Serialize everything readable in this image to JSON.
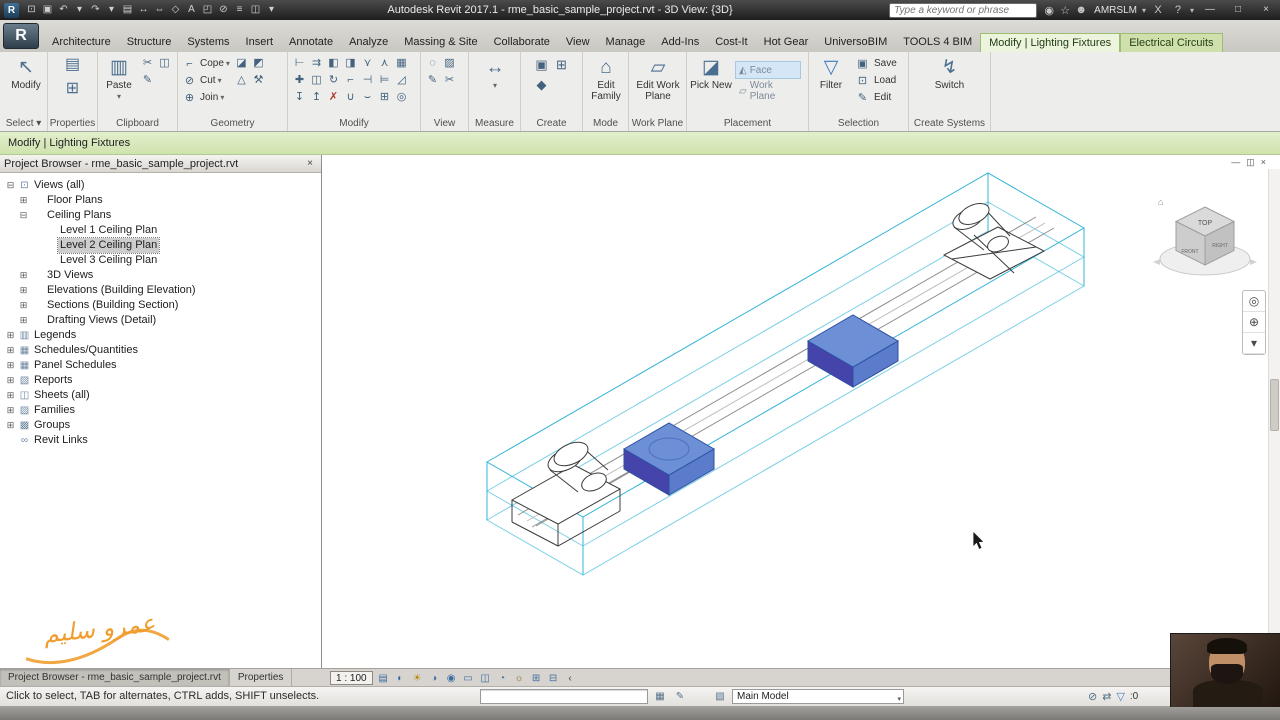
{
  "theme": {
    "model_cyan": "#35b5d8",
    "selection_blue_top": "#6d8fd6",
    "selection_blue_left": "#44a",
    "selection_blue_right": "#5a7cca",
    "selection_blue_edge": "#2e51a3",
    "contextual_green": "#e2efcd",
    "watermark_orange": "#f09d2e"
  },
  "glyphs": {
    "caret": "▾",
    "expand_toggle": "▾"
  },
  "titlebar": {
    "app_icon": "R",
    "title": "Autodesk Revit 2017.1 - rme_basic_sample_project.rvt - 3D View: {3D}",
    "qat": [
      {
        "name": "open-icon",
        "glyph": "⊡"
      },
      {
        "name": "save-icon",
        "glyph": "▣"
      },
      {
        "name": "undo-icon",
        "glyph": "↶"
      },
      {
        "name": "undo-caret-icon",
        "glyph": "▾"
      },
      {
        "name": "redo-icon",
        "glyph": "↷"
      },
      {
        "name": "redo-caret-icon",
        "glyph": "▾"
      },
      {
        "name": "print-icon",
        "glyph": "▤"
      },
      {
        "name": "measure-qat-icon",
        "glyph": "↔"
      },
      {
        "name": "aligned-dimension-icon",
        "glyph": "⇔"
      },
      {
        "name": "tag-by-category-icon",
        "glyph": "◇"
      },
      {
        "name": "text-icon",
        "glyph": "A"
      },
      {
        "name": "default-3d-view-icon",
        "glyph": "◰"
      },
      {
        "name": "section-icon",
        "glyph": "⊘"
      },
      {
        "name": "thin-lines-icon",
        "glyph": "≡"
      },
      {
        "name": "switch-windows-icon",
        "glyph": "◫"
      },
      {
        "name": "customize-qat-icon",
        "glyph": "▾"
      }
    ],
    "search_placeholder": "Type a keyword or phrase",
    "search_icons": [
      {
        "name": "search-binoculars-icon",
        "glyph": "◉"
      },
      {
        "name": "favorites-star-icon",
        "glyph": "☆"
      },
      {
        "name": "sign-in-user-icon",
        "glyph": "☻"
      }
    ],
    "user": "AMRSLM",
    "user_caret": "▾",
    "exchange_apps": "X",
    "help": "?",
    "help_caret": "▾",
    "window": {
      "minimize": "—",
      "maximize": "□",
      "close": "×"
    }
  },
  "ribbon": {
    "app_button": "R",
    "ribbon_toggle": "▾",
    "tabs": [
      {
        "name": "tab-architecture",
        "label": "Architecture"
      },
      {
        "name": "tab-structure",
        "label": "Structure"
      },
      {
        "name": "tab-systems",
        "label": "Systems"
      },
      {
        "name": "tab-insert",
        "label": "Insert"
      },
      {
        "name": "tab-annotate",
        "label": "Annotate"
      },
      {
        "name": "tab-analyze",
        "label": "Analyze"
      },
      {
        "name": "tab-massing-site",
        "label": "Massing & Site"
      },
      {
        "name": "tab-collaborate",
        "label": "Collaborate"
      },
      {
        "name": "tab-view",
        "label": "View"
      },
      {
        "name": "tab-manage",
        "label": "Manage"
      },
      {
        "name": "tab-add-ins",
        "label": "Add-Ins"
      },
      {
        "name": "tab-cost-it",
        "label": "Cost-It"
      },
      {
        "name": "tab-hot-gear",
        "label": "Hot Gear"
      },
      {
        "name": "tab-universobim",
        "label": "UniversoBIM"
      },
      {
        "name": "tab-tools-4-bim",
        "label": "TOOLS 4 BIM"
      },
      {
        "name": "tab-modify-lighting-fixtures",
        "label": "Modify | Lighting Fixtures",
        "state": "contextual-active"
      },
      {
        "name": "tab-electrical-circuits",
        "label": "Electrical Circuits",
        "state": "contextual"
      }
    ],
    "select_panel": {
      "label": "Select ▾",
      "modify_icon": "↖",
      "modify_label": "Modify"
    },
    "properties_panel": {
      "label": "Properties",
      "icons": [
        {
          "name": "properties-palette-icon",
          "glyph": "▤"
        },
        {
          "name": "family-types-icon",
          "glyph": "⊞"
        }
      ]
    },
    "clipboard_panel": {
      "label": "Clipboard",
      "paste_icon": "▥",
      "paste_label": "Paste",
      "paste_caret": "▾",
      "icons": [
        {
          "name": "cut-icon",
          "glyph": "✂"
        },
        {
          "name": "copy-icon",
          "glyph": "◫"
        },
        {
          "name": "match-type-icon",
          "glyph": "✎"
        }
      ]
    },
    "geometry_panel": {
      "label": "Geometry",
      "rows": [
        {
          "name": "cope-button",
          "icon": "⌐",
          "label": "Cope",
          "caret": "▾"
        },
        {
          "name": "cut-button",
          "icon": "⊘",
          "label": "Cut",
          "caret": "▾"
        },
        {
          "name": "join-button",
          "icon": "⊕",
          "label": "Join",
          "caret": "▾"
        }
      ],
      "icons": [
        {
          "name": "paint-icon",
          "glyph": "◪"
        },
        {
          "name": "remove-paint-icon",
          "glyph": "◩"
        },
        {
          "name": "split-face-icon",
          "glyph": "△"
        },
        {
          "name": "demolish-icon",
          "glyph": "⚒"
        }
      ]
    },
    "modify_panel": {
      "label": "Modify",
      "icons": [
        {
          "name": "align-icon",
          "glyph": "⊢"
        },
        {
          "name": "offset-icon",
          "glyph": "⇉"
        },
        {
          "name": "mirror-pick-axis-icon",
          "glyph": "◧"
        },
        {
          "name": "mirror-draw-axis-icon",
          "glyph": "◨"
        },
        {
          "name": "split-element-icon",
          "glyph": "⋎"
        },
        {
          "name": "split-with-gap-icon",
          "glyph": "⋏"
        },
        {
          "name": "array-icon",
          "glyph": "▦"
        },
        {
          "name": "move-icon",
          "glyph": "✚"
        },
        {
          "name": "copy-icon",
          "glyph": "◫"
        },
        {
          "name": "rotate-icon",
          "glyph": "↻"
        },
        {
          "name": "trim-extend-corner-icon",
          "glyph": "⌐"
        },
        {
          "name": "trim-extend-single-icon",
          "glyph": "⊣"
        },
        {
          "name": "trim-extend-multiple-icon",
          "glyph": "⊨"
        },
        {
          "name": "scale-icon",
          "glyph": "◿"
        },
        {
          "name": "pin-icon",
          "glyph": "↧"
        },
        {
          "name": "unpin-icon",
          "glyph": "↥"
        },
        {
          "name": "delete-icon",
          "glyph": "✗",
          "color": "#b03a2e"
        },
        {
          "name": "join-geometry-icon",
          "glyph": "∪"
        },
        {
          "name": "unjoin-geometry-icon",
          "glyph": "⌣"
        },
        {
          "name": "wall-joins-icon",
          "glyph": "⊞"
        },
        {
          "name": "activate-controls-icon",
          "glyph": "◎"
        }
      ]
    },
    "view_panel": {
      "label": "View",
      "icons": [
        {
          "name": "hide-elements-icon",
          "glyph": "◌"
        },
        {
          "name": "override-graphics-icon",
          "glyph": "▨"
        },
        {
          "name": "linework-icon",
          "glyph": "✎"
        },
        {
          "name": "cut-profile-icon",
          "glyph": "✂"
        }
      ]
    },
    "measure_panel": {
      "label": "Measure",
      "icon": "↔",
      "caret": "▾"
    },
    "create_panel": {
      "label": "Create",
      "icons": [
        {
          "name": "create-parts-icon",
          "glyph": "▣"
        },
        {
          "name": "create-group-icon",
          "glyph": "⊞"
        },
        {
          "name": "create-similar-icon",
          "glyph": "◆"
        }
      ]
    },
    "mode_panel": {
      "label": "Mode",
      "edit_family_icon": "⌂",
      "edit_family_label": "Edit Family"
    },
    "work_plane_panel": {
      "label": "Work Plane",
      "edit_work_plane_icon": "▱",
      "edit_work_plane_label": "Edit Work Plane"
    },
    "placement_panel": {
      "label": "Placement",
      "pick_new_icon": "◪",
      "pick_new_label": "Pick New",
      "face_icon": "◭",
      "face_label": "Face",
      "work_plane_icon": "▱",
      "work_plane_label": "Work Plane"
    },
    "selection_panel": {
      "label": "Selection",
      "filter_icon": "▽",
      "filter_label": "Filter",
      "items": [
        {
          "name": "save-selection-button",
          "glyph": "▣",
          "label": "Save"
        },
        {
          "name": "load-selection-button",
          "glyph": "⊡",
          "label": "Load"
        },
        {
          "name": "edit-selection-button",
          "glyph": "✎",
          "label": "Edit"
        }
      ]
    },
    "create_systems_panel": {
      "label": "Create Systems",
      "switch_icon": "↯",
      "switch_label": "Switch"
    }
  },
  "context_bar": {
    "label": "Modify | Lighting Fixtures"
  },
  "project_browser": {
    "title": "Project Browser - rme_basic_sample_project.rvt",
    "close": "×",
    "tree": [
      {
        "name": "tree-item-views-all",
        "indent": 0,
        "glyph": "⊟",
        "icon": "⊡",
        "label": "Views (all)"
      },
      {
        "name": "tree-item-floor-plans",
        "indent": 1,
        "glyph": "⊞",
        "icon": "",
        "label": "Floor Plans"
      },
      {
        "name": "tree-item-ceiling-plans",
        "indent": 1,
        "glyph": "⊟",
        "icon": "",
        "label": "Ceiling Plans"
      },
      {
        "name": "tree-item-level-1-ceiling-plan",
        "indent": 2,
        "glyph": "",
        "icon": "",
        "label": "Level 1 Ceiling Plan"
      },
      {
        "name": "tree-item-level-2-ceiling-plan",
        "indent": 2,
        "glyph": "",
        "icon": "",
        "label": "Level 2 Ceiling Plan",
        "selected": true
      },
      {
        "name": "tree-item-level-3-ceiling-plan",
        "indent": 2,
        "glyph": "",
        "icon": "",
        "label": "Level 3 Ceiling Plan"
      },
      {
        "name": "tree-item-3d-views",
        "indent": 1,
        "glyph": "⊞",
        "icon": "",
        "label": "3D Views"
      },
      {
        "name": "tree-item-elevations",
        "indent": 1,
        "glyph": "⊞",
        "icon": "",
        "label": "Elevations (Building Elevation)"
      },
      {
        "name": "tree-item-sections",
        "indent": 1,
        "glyph": "⊞",
        "icon": "",
        "label": "Sections (Building Section)"
      },
      {
        "name": "tree-item-drafting-views",
        "indent": 1,
        "glyph": "⊞",
        "icon": "",
        "label": "Drafting Views (Detail)"
      },
      {
        "name": "tree-item-legends",
        "indent": 0,
        "glyph": "⊞",
        "icon": "▥",
        "label": "Legends"
      },
      {
        "name": "tree-item-schedules",
        "indent": 0,
        "glyph": "⊞",
        "icon": "▦",
        "label": "Schedules/Quantities"
      },
      {
        "name": "tree-item-panel-schedules",
        "indent": 0,
        "glyph": "⊞",
        "icon": "▦",
        "label": "Panel Schedules"
      },
      {
        "name": "tree-item-reports",
        "indent": 0,
        "glyph": "⊞",
        "icon": "▧",
        "label": "Reports"
      },
      {
        "name": "tree-item-sheets",
        "indent": 0,
        "glyph": "⊞",
        "icon": "◫",
        "label": "Sheets (all)"
      },
      {
        "name": "tree-item-families",
        "indent": 0,
        "glyph": "⊞",
        "icon": "▨",
        "label": "Families"
      },
      {
        "name": "tree-item-groups",
        "indent": 0,
        "glyph": "⊞",
        "icon": "▩",
        "label": "Groups"
      },
      {
        "name": "tree-item-revit-links",
        "indent": 0,
        "glyph": "",
        "icon": "∞",
        "label": "Revit Links"
      }
    ]
  },
  "viewport": {
    "window_controls": [
      {
        "name": "view-minimize-icon",
        "glyph": "—"
      },
      {
        "name": "view-restore-icon",
        "glyph": "◫"
      },
      {
        "name": "view-close-icon",
        "glyph": "×"
      }
    ],
    "viewcube": {
      "top": "TOP",
      "front": "FRONT",
      "right": "RIGHT",
      "home_glyph": "⌂"
    },
    "navbar": [
      {
        "name": "steering-wheel-icon",
        "glyph": "◎"
      },
      {
        "name": "zoom-icon",
        "glyph": "⊕"
      },
      {
        "name": "navbar-caret-icon",
        "glyph": "▾"
      }
    ]
  },
  "view_control_bar": {
    "scale": "1 : 100",
    "icons": [
      {
        "name": "detail-level-icon",
        "glyph": "▤"
      },
      {
        "name": "visual-style-icon",
        "glyph": "◐"
      },
      {
        "name": "sun-path-icon",
        "glyph": "☀",
        "color": "#b8860b"
      },
      {
        "name": "shadows-icon",
        "glyph": "◑"
      },
      {
        "name": "rendering-dialog-icon",
        "glyph": "◉"
      },
      {
        "name": "crop-view-icon",
        "glyph": "▭"
      },
      {
        "name": "show-crop-region-icon",
        "glyph": "◫"
      },
      {
        "name": "temporary-hide-isolate-icon",
        "glyph": "◔"
      },
      {
        "name": "reveal-hidden-elements-icon",
        "glyph": "☼",
        "color": "#8a6d1a"
      },
      {
        "name": "temporary-view-properties-icon",
        "glyph": "⊞"
      },
      {
        "name": "show-constraints-icon",
        "glyph": "⊟"
      },
      {
        "name": "expand-vcb-icon",
        "glyph": "‹",
        "color": "#444444"
      }
    ]
  },
  "bottom_tabs": [
    {
      "name": "tab-project-browser-bottom",
      "label": "Project Browser - rme_basic_sample_project.rvt",
      "active": true
    },
    {
      "name": "tab-properties-bottom",
      "label": "Properties"
    }
  ],
  "status_bar": {
    "hint": "Click to select, TAB for alternates, CTRL adds, SHIFT unselects.",
    "worksets_icon": "▦",
    "editable_only_icon": "✎",
    "design_options_icon": "▧",
    "design_option": "Main Model",
    "design_caret": "▾",
    "icons": [
      {
        "name": "exclude-options-icon",
        "glyph": "⊘"
      },
      {
        "name": "press-drag-icon",
        "glyph": "⇄"
      },
      {
        "name": "selection-filter-icon",
        "glyph": "▽",
        "color": "#3f7dbf"
      }
    ],
    "selection_count": ":0"
  },
  "watermark": {
    "text": "عمرو سليم"
  }
}
